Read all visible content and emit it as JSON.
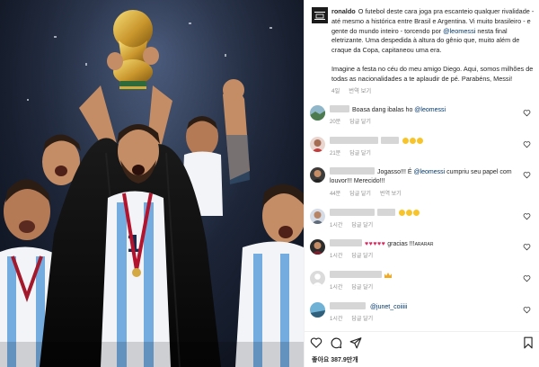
{
  "post": {
    "image_alt": "",
    "avatar_text": "",
    "username": "ronaldo",
    "caption_part1": "O futebol deste cara joga pra escanteio qualquer rivalidade - até mesmo a histórica entre Brasil e Argentina. Vi muito brasileiro - e gente do mundo inteiro - torcendo por",
    "caption_mention": "@leomessi",
    "caption_part2": "nesta final eletrizante. Uma despedida à altura do gênio que, muito além de craque da Copa, capitaneou uma era.",
    "caption_para2": "Imagine a festa no céu do meu amigo Diego. Aqui, somos milhões de todas as nacionalidades a te aplaudir de pé. Parabéns, Messi!",
    "time": "4일",
    "translate": "번역 보기"
  },
  "comments": [
    {
      "text": "Boasa dang ibalas ho",
      "mention": "@leomessi",
      "time": "20분",
      "reply": "답글 달기",
      "translate": "",
      "avatar": "landscape",
      "tail": ""
    },
    {
      "text": "",
      "mention": "",
      "time": "21분",
      "reply": "답글 달기",
      "translate": "",
      "avatar": "person-red",
      "tail": ""
    },
    {
      "text": "Jogasso!!! É",
      "mention": "@leomessi",
      "tail": "cumpriu seu papel com louvor!!! Merecido!!!",
      "time": "44분",
      "reply": "답글 달기",
      "translate": "번역 보기",
      "avatar": "person-dark"
    },
    {
      "text": "",
      "mention": "",
      "time": "1시간",
      "reply": "답글 달기",
      "translate": "",
      "avatar": "person-light",
      "tail": ""
    },
    {
      "text": "gracias !!!",
      "mention": "",
      "tail": "ARARAR",
      "time": "1시간",
      "reply": "답글 달기",
      "translate": "",
      "avatar": "person-dark2"
    },
    {
      "text": "",
      "mention": "",
      "time": "1시간",
      "reply": "답글 달기",
      "translate": "",
      "avatar": "default",
      "tail": ""
    },
    {
      "text": "",
      "mention": "@junet_coiiiii",
      "time": "1시간",
      "reply": "답글 달기",
      "translate": "",
      "avatar": "landscape2",
      "tail": ""
    }
  ],
  "footer": {
    "likes": "좋아요 387.9만개",
    "icons": [
      "heart-icon",
      "comment-icon",
      "share-icon",
      "bookmark-icon"
    ]
  },
  "colors": {
    "mention": "#00376b",
    "meta": "#8e8e8e",
    "text": "#262626",
    "heart_emoji": "#e0245e"
  }
}
